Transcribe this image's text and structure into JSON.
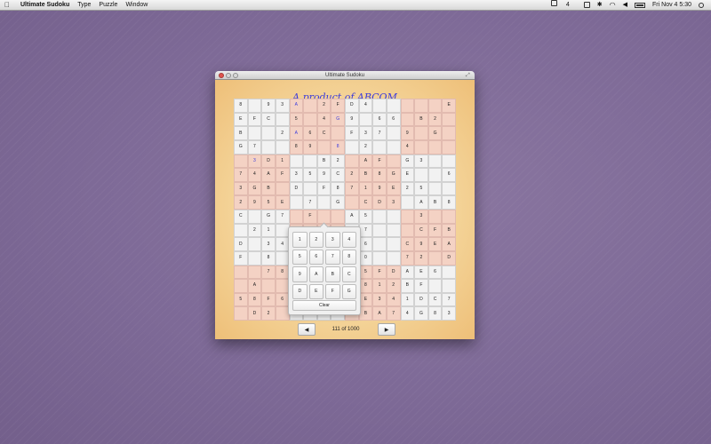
{
  "menubar": {
    "apple_icon": "apple-icon",
    "app_name": "Ultimate Sudoku",
    "menus": [
      "Type",
      "Puzzle",
      "Window"
    ],
    "status": {
      "badge": "4",
      "clock": "Fri Nov 4  5:30"
    }
  },
  "window": {
    "title": "Ultimate Sudoku",
    "banner": "A product of ABCOM",
    "counter": "111 of 1000",
    "prev_label": "◀",
    "next_label": "▶"
  },
  "grid": {
    "rows": [
      [
        "8",
        "",
        "9",
        "3",
        "A",
        "",
        "2",
        "F",
        "D",
        "4",
        "",
        "",
        "",
        "",
        "",
        "E"
      ],
      [
        "E",
        "F",
        "C",
        "",
        "5",
        "",
        "4",
        "G",
        "9",
        "",
        "6",
        "6",
        "",
        "B",
        "2",
        ""
      ],
      [
        "B",
        "",
        "",
        "2",
        "A",
        "6",
        "C",
        "",
        "F",
        "3",
        "7",
        "",
        "9",
        "",
        "G",
        ""
      ],
      [
        "G",
        "7",
        "",
        "",
        "8",
        "9",
        "",
        "8",
        "",
        "2",
        "",
        "",
        "4",
        "",
        "",
        ""
      ],
      [
        "",
        "3",
        "D",
        "1",
        "",
        "",
        "B",
        "2",
        "",
        "A",
        "F",
        "",
        "G",
        "3",
        "",
        ""
      ],
      [
        "7",
        "4",
        "A",
        "F",
        "3",
        "5",
        "9",
        "C",
        "2",
        "B",
        "8",
        "G",
        "E",
        "",
        "",
        "6"
      ],
      [
        "3",
        "G",
        "B",
        "",
        "D",
        "",
        "F",
        "8",
        "7",
        "1",
        "9",
        "E",
        "2",
        "5",
        "",
        ""
      ],
      [
        "2",
        "9",
        "5",
        "E",
        "",
        "7",
        "",
        "G",
        "",
        "C",
        "D",
        "3",
        "",
        "A",
        "B",
        "8"
      ],
      [
        "C",
        "",
        "G",
        "7",
        "",
        "F",
        "",
        "",
        "A",
        "5",
        "",
        "",
        "",
        "3",
        "",
        ""
      ],
      [
        "",
        "2",
        "1",
        "",
        "",
        "",
        "",
        "",
        "",
        "7",
        "",
        "",
        "",
        "C",
        "F",
        "B"
      ],
      [
        "D",
        "",
        "3",
        "4",
        "",
        "",
        "",
        "",
        "",
        "6",
        "",
        "",
        "C",
        "9",
        "E",
        "A"
      ],
      [
        "F",
        "",
        "8",
        "",
        "",
        "",
        "",
        "",
        "",
        "0",
        "",
        "",
        "7",
        "2",
        "",
        "D"
      ],
      [
        "",
        "",
        "7",
        "8",
        "",
        "",
        "",
        "",
        "",
        "5",
        "F",
        "D",
        "A",
        "E",
        "6",
        ""
      ],
      [
        "",
        "A",
        "",
        "",
        "",
        "",
        "",
        "",
        "",
        "8",
        "1",
        "2",
        "B",
        "F",
        "",
        ""
      ],
      [
        "5",
        "8",
        "F",
        "6",
        "",
        "",
        "",
        "",
        "",
        "E",
        "3",
        "4",
        "1",
        "D",
        "C",
        "7"
      ],
      [
        "",
        "D",
        "2",
        "",
        "",
        "",
        "",
        "",
        "",
        "B",
        "A",
        "7",
        "4",
        "G",
        "8",
        "3"
      ]
    ],
    "blue_cells": [
      "0-4",
      "1-7",
      "2-4",
      "3-7",
      "4-1"
    ]
  },
  "pad": {
    "keys": [
      "1",
      "2",
      "3",
      "4",
      "5",
      "6",
      "7",
      "8",
      "9",
      "A",
      "B",
      "C",
      "D",
      "E",
      "F",
      "G"
    ],
    "clear_label": "Clear"
  }
}
